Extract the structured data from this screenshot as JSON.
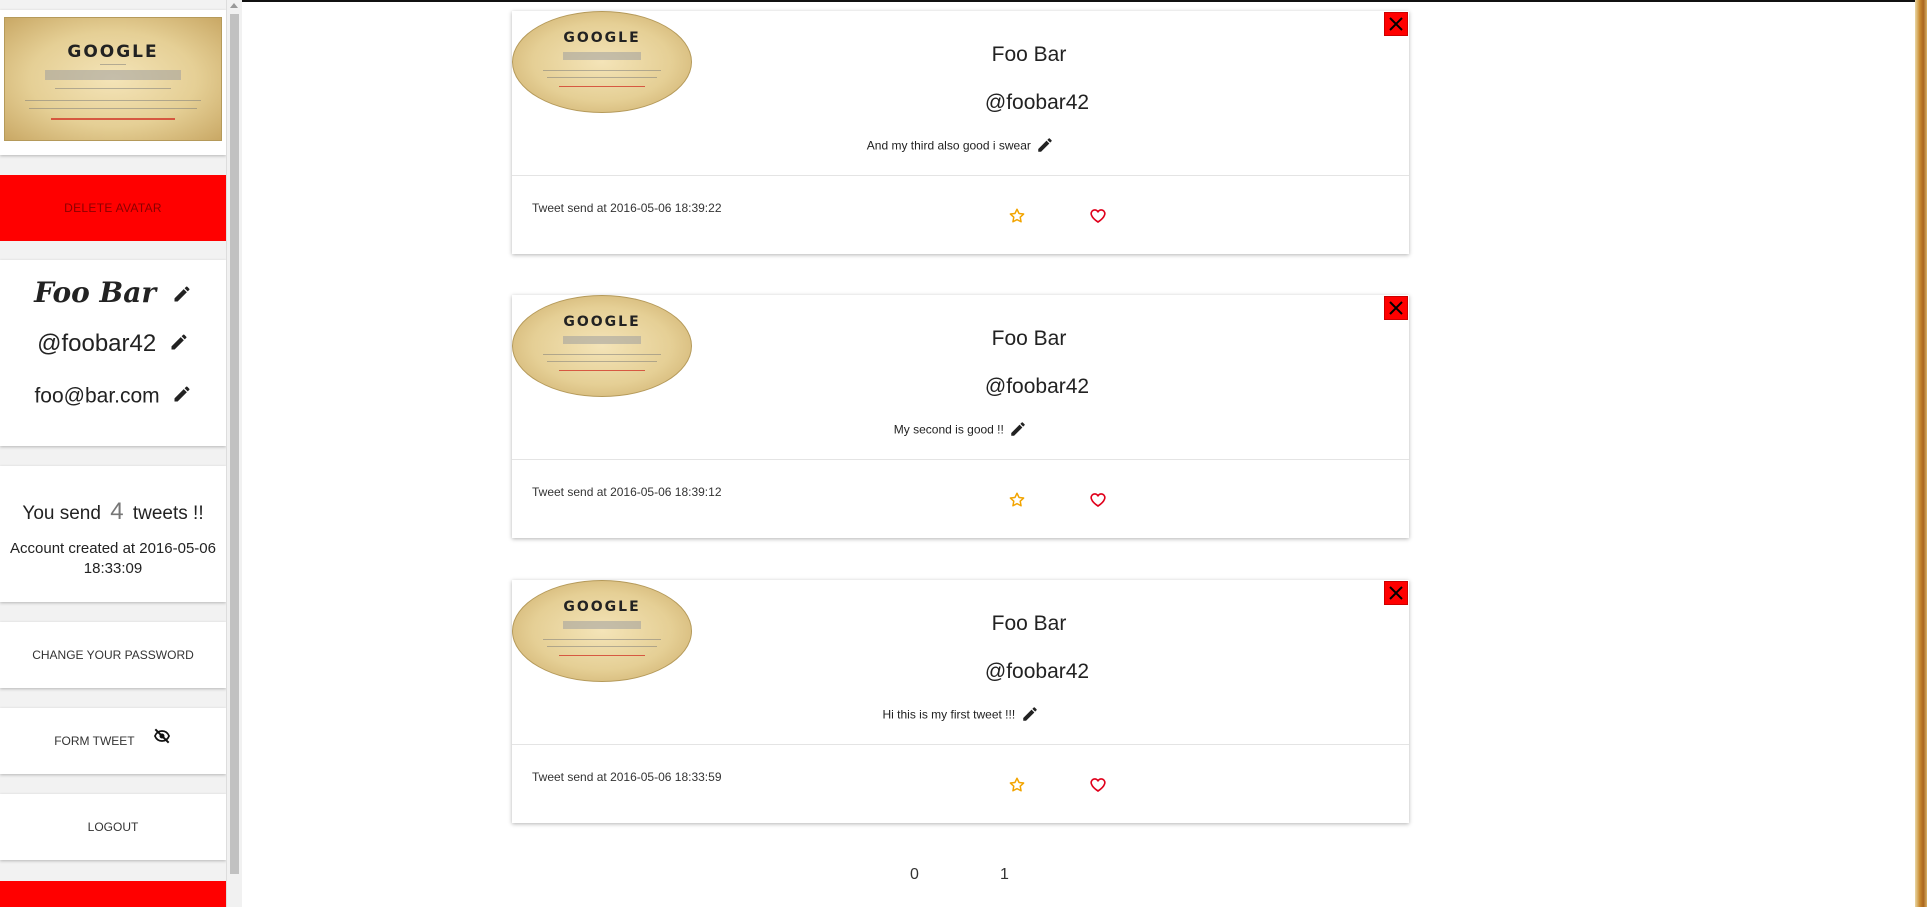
{
  "sidebar": {
    "avatar_poster": {
      "logo": "GOOGLE",
      "subtitle": "CLASSIC",
      "caption": "PLEASE INSERT 25 DAYS FOR SEARCH RESULTS"
    },
    "delete_avatar_label": "DELETE AVATAR",
    "profile": {
      "name": "Foo Bar",
      "handle": "@foobar42",
      "email": "foo@bar.com"
    },
    "stats": {
      "prefix": "You send",
      "count": "4",
      "suffix": "tweets !!",
      "created_prefix": "Account created at",
      "created_value": "2016-05-06 18:33:09"
    },
    "menu": {
      "change_password": "CHANGE YOUR PASSWORD",
      "form_tweet": "FORM TWEET",
      "logout": "LOGOUT"
    }
  },
  "tweets": [
    {
      "name": "Foo Bar",
      "handle": "@foobar42",
      "text": "And my third also good i swear",
      "sent_prefix": "Tweet send at",
      "sent_at": "2016-05-06 18:39:22"
    },
    {
      "name": "Foo Bar",
      "handle": "@foobar42",
      "text": "My second is good !!",
      "sent_prefix": "Tweet send at",
      "sent_at": "2016-05-06 18:39:12"
    },
    {
      "name": "Foo Bar",
      "handle": "@foobar42",
      "text": "Hi this is my first tweet !!!",
      "sent_prefix": "Tweet send at",
      "sent_at": "2016-05-06 18:33:59"
    }
  ],
  "pagination": [
    "0",
    "1"
  ],
  "icons": {
    "edit": "pencil-icon",
    "hide": "eye-off-icon",
    "close": "close-icon",
    "favorite": "star-icon",
    "like": "heart-icon"
  },
  "colors": {
    "danger": "#ff0000",
    "star": "#f2a400",
    "heart": "#e0001b"
  }
}
